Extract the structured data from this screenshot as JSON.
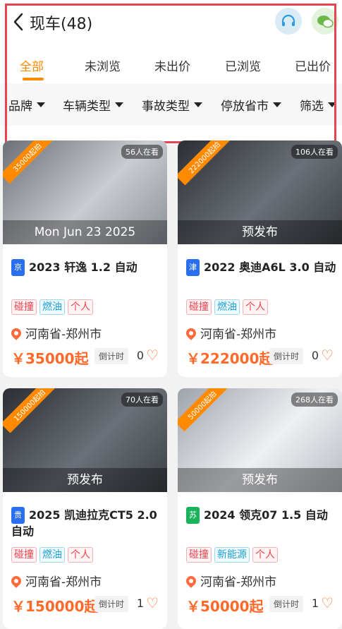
{
  "header": {
    "title": "现车(48)"
  },
  "tabs": [
    {
      "label": "全部",
      "active": true
    },
    {
      "label": "未浏览",
      "active": false
    },
    {
      "label": "未出价",
      "active": false
    },
    {
      "label": "已浏览",
      "active": false
    },
    {
      "label": "已出价",
      "active": false
    }
  ],
  "filters": [
    {
      "label": "品牌"
    },
    {
      "label": "车辆类型"
    },
    {
      "label": "事故类型"
    },
    {
      "label": "停放省市"
    },
    {
      "label": "筛选"
    }
  ],
  "cards": [
    {
      "watching": "56人在看",
      "ribbon": "35000起拍",
      "overlay": "Mon Jun 23 2025",
      "plate": "京",
      "name": "2023 轩逸 1.2 自动",
      "tags": [
        "碰撞",
        "燃油",
        "个人"
      ],
      "location": "河南省-郑州市",
      "price": "￥35000起",
      "countdown": "倒计时",
      "likes": "0"
    },
    {
      "watching": "106人在看",
      "ribbon": "222000起拍",
      "overlay": "预发布",
      "plate": "津",
      "name": "2022 奥迪A6L 3.0 自动",
      "tags": [
        "碰撞",
        "燃油",
        "个人"
      ],
      "location": "河南省-郑州市",
      "price": "￥222000起",
      "countdown": "倒计时",
      "likes": "0"
    },
    {
      "watching": "70人在看",
      "ribbon": "150000起拍",
      "overlay": "预发布",
      "plate": "贵",
      "name": "2025 凯迪拉克CT5 2.0 自动",
      "tags": [
        "碰撞",
        "燃油",
        "个人"
      ],
      "location": "河南省-郑州市",
      "price": "￥150000起",
      "countdown": "倒计时",
      "likes": "1"
    },
    {
      "watching": "268人在看",
      "ribbon": "50000起拍",
      "overlay": "预发布",
      "plate": "苏",
      "name": "2024 领克07 1.5 自动",
      "tags": [
        "碰撞",
        "新能源",
        "个人"
      ],
      "location": "河南省-郑州市",
      "price": "￥50000起",
      "countdown": "倒计时",
      "likes": "1"
    }
  ]
}
